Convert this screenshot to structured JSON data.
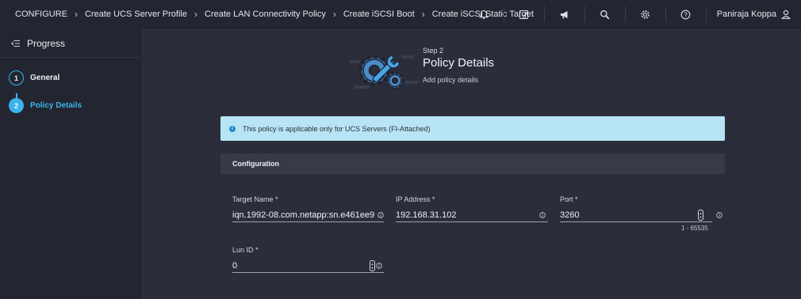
{
  "breadcrumb": [
    "CONFIGURE",
    "Create UCS Server Profile",
    "Create LAN Connectivity Policy",
    "Create iSCSI Boot",
    "Create iSCSI Static Target"
  ],
  "header_icons": [
    "bell-icon",
    "tasks-checklist-icon",
    "megaphone-icon",
    "search-icon",
    "gear-icon",
    "help-icon"
  ],
  "user": {
    "name": "Paniraja Koppa",
    "icon": "user-icon"
  },
  "sidebar": {
    "title": "Progress",
    "steps": [
      {
        "number": "1",
        "label": "General",
        "state": "completed"
      },
      {
        "number": "2",
        "label": "Policy Details",
        "state": "active"
      }
    ]
  },
  "page": {
    "step": "Step 2",
    "title": "Policy Details",
    "subtitle": "Add policy details"
  },
  "info_banner": "This policy is applicable only for UCS Servers (FI-Attached)",
  "section_title": "Configuration",
  "fields": {
    "target_name": {
      "label": "Target Name *",
      "value": "iqn.1992-08.com.netapp:sn.e461ee9"
    },
    "ip_address": {
      "label": "IP Address *",
      "value": "192.168.31.102"
    },
    "port": {
      "label": "Port *",
      "value": "3260",
      "range": "1 - 65535"
    },
    "lun_id": {
      "label": "Lun ID *",
      "value": "0"
    }
  },
  "colors": {
    "accent": "#3ab4ea",
    "banner": "#b8e5f5",
    "background": "#2b2e3a",
    "panel": "#232631"
  }
}
